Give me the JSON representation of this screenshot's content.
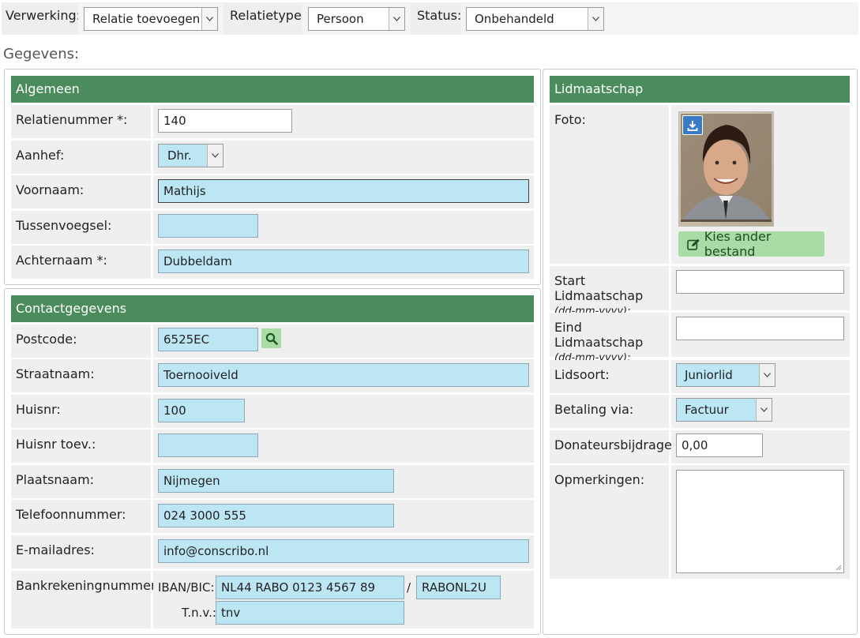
{
  "toolbar": {
    "verwerking_label": "Verwerking:",
    "verwerking_value": "Relatie toevoegen",
    "relatietype_label": "Relatietype:",
    "relatietype_value": "Persoon",
    "status_label": "Status:",
    "status_value": "Onbehandeld"
  },
  "section_title": "Gegevens:",
  "algemeen": {
    "header": "Algemeen",
    "relatienummer_label": "Relatienummer *:",
    "relatienummer_value": "140",
    "aanhef_label": "Aanhef:",
    "aanhef_value": "Dhr.",
    "voornaam_label": "Voornaam:",
    "voornaam_value": "Mathijs",
    "tussenvoegsel_label": "Tussenvoegsel:",
    "tussenvoegsel_value": "",
    "achternaam_label": "Achternaam *:",
    "achternaam_value": "Dubbeldam"
  },
  "contact": {
    "header": "Contactgegevens",
    "postcode_label": "Postcode:",
    "postcode_value": "6525EC",
    "straatnaam_label": "Straatnaam:",
    "straatnaam_value": "Toernooiveld",
    "huisnr_label": "Huisnr:",
    "huisnr_value": "100",
    "huisnr_toev_label": "Huisnr toev.:",
    "huisnr_toev_value": "",
    "plaatsnaam_label": "Plaatsnaam:",
    "plaatsnaam_value": "Nijmegen",
    "telefoon_label": "Telefoonnummer:",
    "telefoon_value": "024 3000 555",
    "email_label": "E-mailadres:",
    "email_value": "info@conscribo.nl",
    "bank_label": "Bankrekeningnummer:",
    "iban_bic_label": "IBAN/BIC:",
    "iban_value": "NL44 RABO 0123 4567 89",
    "separator": "/",
    "bic_value": "RABONL2U",
    "tnv_label": "T.n.v.:",
    "tnv_value": "tnv"
  },
  "lidmaatschap": {
    "header": "Lidmaatschap",
    "foto_label": "Foto:",
    "kies_button": "Kies ander bestand",
    "start_label": "Start Lidmaatschap",
    "start_format": "(dd-mm-yyyy):",
    "start_value": "",
    "eind_label": "Eind Lidmaatschap",
    "eind_format": "(dd-mm-yyyy):",
    "eind_value": "",
    "lidsoort_label": "Lidsoort:",
    "lidsoort_value": "Juniorlid",
    "betaling_label": "Betaling via:",
    "betaling_value": "Factuur",
    "donateur_label": "Donateursbijdrage:",
    "donateur_value": "0,00",
    "opmerkingen_label": "Opmerkingen:",
    "opmerkingen_value": ""
  },
  "icons": {
    "dropdown": "chevron-down-icon",
    "search": "search-icon",
    "download": "download-icon",
    "edit": "edit-icon",
    "resize": "resize-handle-icon"
  },
  "colors": {
    "header_green": "#4a8c5c",
    "input_blue": "#bde6f5",
    "button_green": "#a8dba6"
  }
}
